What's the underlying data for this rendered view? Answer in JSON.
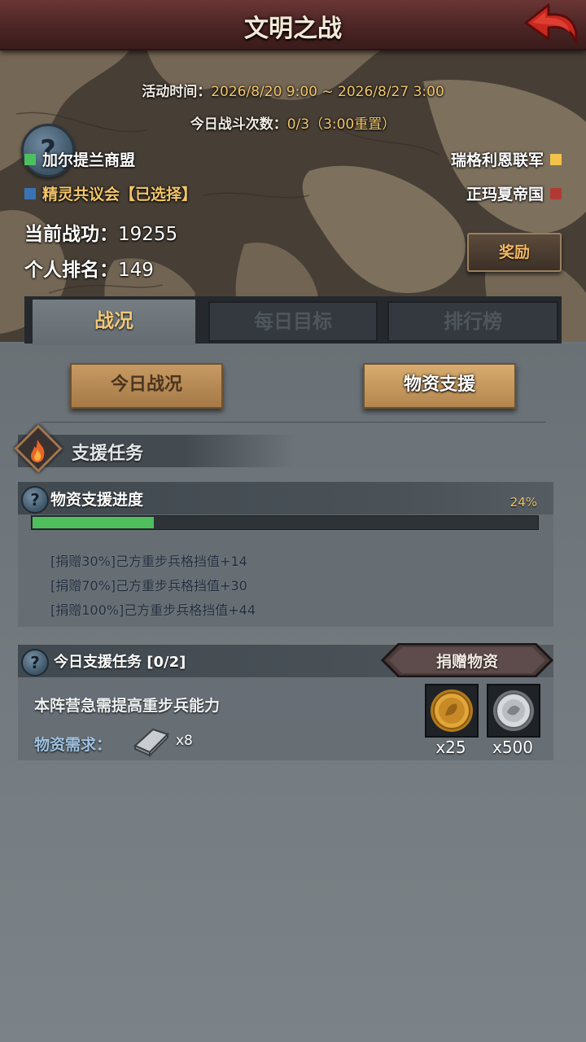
{
  "header": {
    "title": "文明之战",
    "back_icon": "back-arrow-icon"
  },
  "event": {
    "time_label": "活动时间：",
    "time_value": "2026/8/20 9:00 ~ 2026/8/27 3:00",
    "battles_label": "今日战斗次数：",
    "battles_value": "0/3（3:00重置）"
  },
  "factions": [
    {
      "name": "加尔提兰商盟",
      "color": "#4cbf5e",
      "selected": false
    },
    {
      "name": "精灵共议会【已选择】",
      "color": "#3a73b5",
      "selected": true
    },
    {
      "name": "瑞格利恩联军",
      "color": "#f2c24a",
      "selected": false
    },
    {
      "name": "正玛夏帝国",
      "color": "#b23a34",
      "selected": false
    }
  ],
  "stats": {
    "merit_label": "当前战功：",
    "merit_value": "19255",
    "rank_label": "个人排名：",
    "rank_value": "149"
  },
  "reward_button": "奖励",
  "tabs": [
    {
      "label": "战况",
      "active": true
    },
    {
      "label": "每日目标",
      "active": false
    },
    {
      "label": "排行榜",
      "active": false
    }
  ],
  "sub_tabs": [
    {
      "label": "今日战况",
      "active": false
    },
    {
      "label": "物资支援",
      "active": true
    }
  ],
  "section": {
    "title": "支援任务"
  },
  "progress": {
    "title": "物资支援进度",
    "percent_text": "24%",
    "fraction": 0.24,
    "milestones": [
      "[捐赠30%]己方重步兵格挡值+14",
      "[捐赠70%]己方重步兵格挡值+30",
      "[捐赠100%]己方重步兵格挡值+44"
    ]
  },
  "task": {
    "title": "今日支援任务",
    "count": "[0/2]",
    "donate_button": "捐赠物资",
    "description": "本阵营急需提高重步兵能力",
    "need_label": "物资需求：",
    "need_qty": "x8",
    "rewards": [
      {
        "icon": "gold-medal-icon",
        "qty": "x25"
      },
      {
        "icon": "silver-coin-icon",
        "qty": "x500"
      }
    ]
  }
}
